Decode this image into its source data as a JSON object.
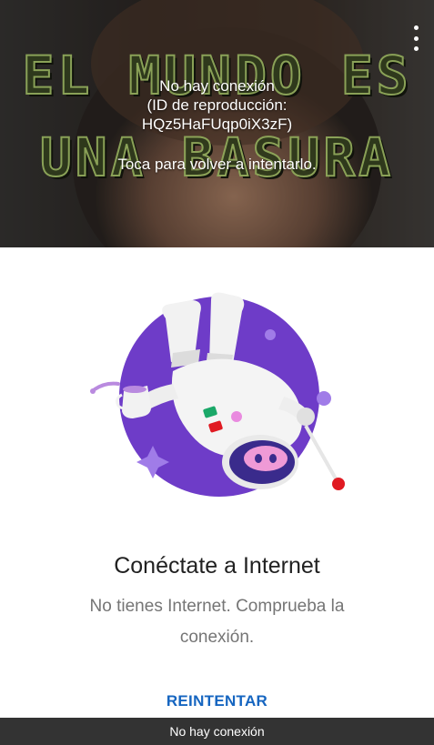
{
  "player": {
    "thumbnail_line1": "EL MUNDO ES",
    "thumbnail_line2": "UNA BASURA",
    "error_line1": "No hay conexión",
    "error_line2": "(ID de reproducción:",
    "error_line3": "HQz5HaFUqp0iX3zF)",
    "retry_hint": "Toca para volver a intentarlo.",
    "menu_icon": "more-vert-icon"
  },
  "offline": {
    "illustration_icon": "astronaut-offline-icon",
    "title": "Conéctate a Internet",
    "subtitle": "No tienes Internet. Comprueba la conexión.",
    "retry_label": "REINTENTAR"
  },
  "snackbar": {
    "message": "No hay conexión"
  },
  "colors": {
    "accent": "#1565c0",
    "illustration_purple": "#6e3cc8",
    "snackbar_bg": "#333333"
  }
}
